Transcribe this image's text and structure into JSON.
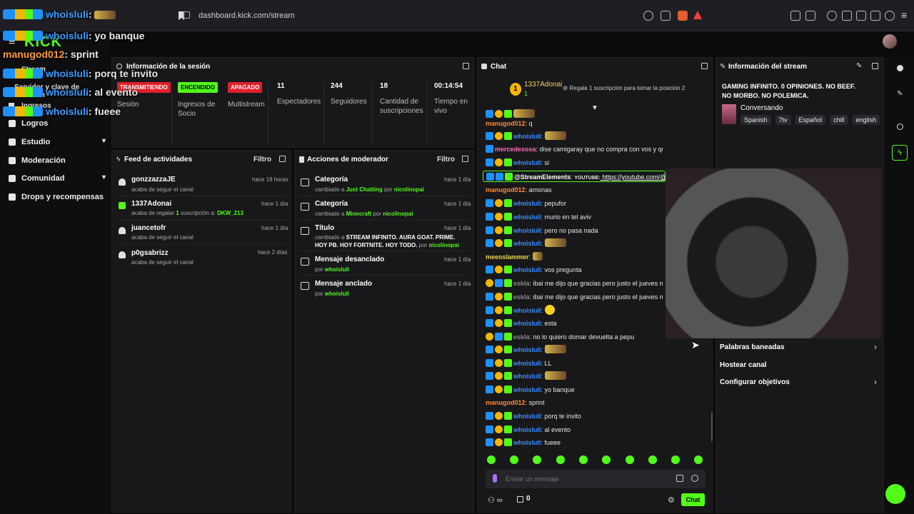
{
  "browser": {
    "url": "dashboard.kick.com/stream"
  },
  "overlay": {
    "lines": [
      {
        "user": "whoisluli",
        "user_color": "blue",
        "text": ""
      },
      {
        "user": "whoisluli",
        "user_color": "blue",
        "text": "yo banque"
      },
      {
        "user": "manugod012",
        "user_color": "orange",
        "text": "sprint"
      },
      {
        "user": "whoisluli",
        "user_color": "blue",
        "text": "porq te invito"
      },
      {
        "user": "whoisluli",
        "user_color": "blue",
        "text": "al evento"
      },
      {
        "user": "whoisluli",
        "user_color": "blue",
        "text": "fueee"
      }
    ]
  },
  "sidebar": {
    "partial_items": [
      "Stream",
      "Servidor y clave de retransm",
      "Ingresos"
    ],
    "items": [
      {
        "label": "Logros",
        "icon": "trophy-icon",
        "chevron": false
      },
      {
        "label": "Estudio",
        "icon": "book-icon",
        "chevron": true
      },
      {
        "label": "Moderación",
        "icon": "wrench-icon",
        "chevron": false
      },
      {
        "label": "Comunidad",
        "icon": "users-icon",
        "chevron": true
      },
      {
        "label": "Drops y recompensas",
        "icon": "gift-icon",
        "chevron": false
      }
    ]
  },
  "session": {
    "title": "Información de la sesión",
    "badges": [
      {
        "text": "TRANSMITIENDO",
        "color": "#e0202a",
        "label": "Sesión"
      },
      {
        "text": "ENCENDIDO",
        "color": "#53fc18",
        "label": "Ingresos de Socio"
      },
      {
        "text": "APAGADO",
        "color": "#e0202a",
        "label": "Multistream"
      }
    ],
    "stats": [
      {
        "value": "11",
        "label": "Espectadores"
      },
      {
        "value": "244",
        "label": "Seguidores"
      },
      {
        "value": "18",
        "label": "Cantidad de suscripciones"
      },
      {
        "value": "00:14:54",
        "label": "Tiempo en vivo"
      }
    ]
  },
  "feed": {
    "title": "Feed de actividades",
    "filter": "Filtro",
    "items": [
      {
        "name": "gonzzazzaJE",
        "sub": "acaba de seguir el canal",
        "time": "hace 19 horas",
        "icon": "heart-icon"
      },
      {
        "name": "1337Adonai",
        "sub_prefix": "acaba de regalar",
        "sub_count": "1",
        "sub_mid": "suscripción a:",
        "sub_target": "DKW_213",
        "time": "hace 1 día",
        "icon": "gift-icon"
      },
      {
        "name": "juancetofr",
        "sub": "acaba de seguir el canal",
        "time": "hace 1 día",
        "icon": "heart-icon"
      },
      {
        "name": "p0gsabrizz",
        "sub": "acaba de seguir el canal",
        "time": "hace 2 días",
        "icon": "heart-icon"
      }
    ]
  },
  "modactions": {
    "title": "Acciones de moderador",
    "filter": "Filtro",
    "items": [
      {
        "title": "Categoría",
        "pre": "cambiado a",
        "value": "Just Chatting",
        "by": "por",
        "user": "nicolinopai",
        "time": "hace 1 día",
        "icon": "category-icon"
      },
      {
        "title": "Categoría",
        "pre": "cambiado a",
        "value": "Minecraft",
        "by": "por",
        "user": "nicolinopai",
        "time": "hace 1 día",
        "icon": "category-icon"
      },
      {
        "title": "Título",
        "pre": "cambiado a",
        "value": "STREAM INFINITO. AURA GOAT. PRIME. HOY PB. HOY FORTNITE. HOY TODO.",
        "by": "por",
        "user": "nicolinopai",
        "time": "hace 1 día",
        "icon": "title-icon"
      },
      {
        "title": "Mensaje desanclado",
        "pre": "por",
        "value": "",
        "by": "",
        "user": "whoisluli",
        "time": "hace 1 día",
        "icon": "unpin-icon"
      },
      {
        "title": "Mensaje anclado",
        "pre": "por",
        "value": "",
        "by": "",
        "user": "whoisluli",
        "time": "hace 1 día",
        "icon": "pin-icon"
      }
    ]
  },
  "chat": {
    "title": "Chat",
    "gift_leader": {
      "name": "1337Adonai",
      "count": "1",
      "prompt": "Regala 1 suscripción para tomar la posición 2"
    },
    "messages": [
      {
        "badges": [
          "blue",
          "coin",
          "green"
        ],
        "user": "",
        "color": "blue",
        "text": "",
        "emote": "wide"
      },
      {
        "badges": [],
        "user": "manugod012",
        "color": "orange",
        "text": "q"
      },
      {
        "badges": [
          "blue",
          "coin",
          "green"
        ],
        "user": "whoisluli",
        "color": "blue",
        "text": "",
        "emote": "wide"
      },
      {
        "badges": [
          "blue"
        ],
        "user": "mercedesosa",
        "color": "pink",
        "text": "dise camigaray que no compra con vos y que sos un moño"
      },
      {
        "badges": [
          "blue",
          "coin",
          "green"
        ],
        "user": "whoisluli",
        "color": "blue",
        "text": "si"
      },
      {
        "badges": [
          "blue",
          "blue",
          "green"
        ],
        "user": "@StreamElements",
        "color": "green",
        "text": "YOUTUBE:",
        "link": "https://youtube.com/@nicol"
      },
      {
        "badges": [],
        "user": "manugod012",
        "color": "orange",
        "text": "amonas"
      },
      {
        "badges": [
          "blue",
          "coin",
          "green"
        ],
        "user": "whoisluli",
        "color": "blue",
        "text": "pepufor"
      },
      {
        "badges": [
          "blue",
          "coin",
          "green"
        ],
        "user": "whoisluli",
        "color": "blue",
        "text": "murio en tel aviv"
      },
      {
        "badges": [
          "blue",
          "coin",
          "green"
        ],
        "user": "whoisluli",
        "color": "blue",
        "text": "pero no pasa nada"
      },
      {
        "badges": [
          "blue",
          "coin",
          "green"
        ],
        "user": "whoisluli",
        "color": "blue",
        "text": "",
        "emote": "wide"
      },
      {
        "badges": [],
        "user": "meeoslammer",
        "color": "yellow",
        "text": "",
        "emote": "small"
      },
      {
        "badges": [
          "blue",
          "coin",
          "green"
        ],
        "user": "whoisluli",
        "color": "blue",
        "text": "vos pregunta"
      },
      {
        "badges": [
          "coin",
          "blue",
          "green"
        ],
        "user": "eskla",
        "color": "gray",
        "text": "ibai me dijo que gracias pero justo el jueves no"
      },
      {
        "badges": [
          "blue",
          "coin",
          "green"
        ],
        "user": "eskla",
        "color": "gray",
        "text": "ibai me dijo que gracias pero justo el jueves no"
      },
      {
        "badges": [
          "blue",
          "coin",
          "green"
        ],
        "user": "whoisluli",
        "color": "blue",
        "text": "",
        "emote": "yellow"
      },
      {
        "badges": [
          "blue",
          "coin",
          "green"
        ],
        "user": "whoisluli",
        "color": "blue",
        "text": "esta"
      },
      {
        "badges": [
          "coin",
          "blue",
          "green"
        ],
        "user": "eskla",
        "color": "gray",
        "text": "no lo quiero domar devuelta a pepu"
      },
      {
        "badges": [
          "blue",
          "coin",
          "green"
        ],
        "user": "whoisluli",
        "color": "blue",
        "text": "",
        "emote": "wide"
      },
      {
        "badges": [
          "blue",
          "coin",
          "green"
        ],
        "user": "whoisluli",
        "color": "blue",
        "text": "LL"
      },
      {
        "badges": [
          "blue",
          "coin",
          "green"
        ],
        "user": "whoisluli",
        "color": "blue",
        "text": "",
        "emote": "wide"
      },
      {
        "badges": [
          "blue",
          "coin",
          "green"
        ],
        "user": "whoisluli",
        "color": "blue",
        "text": "yo banque"
      },
      {
        "badges": [],
        "user": "manugod012",
        "color": "orange",
        "text": "sprint"
      },
      {
        "badges": [
          "blue",
          "coin",
          "green"
        ],
        "user": "whoisluli",
        "color": "blue",
        "text": "porq te invito"
      },
      {
        "badges": [
          "blue",
          "coin",
          "green"
        ],
        "user": "whoisluli",
        "color": "blue",
        "text": "al evento"
      },
      {
        "badges": [
          "blue",
          "coin",
          "green"
        ],
        "user": "whoisluli",
        "color": "blue",
        "text": "fueee"
      }
    ],
    "input_placeholder": "Enviar un mensaje",
    "footer_count": "0",
    "send_label": "Chat"
  },
  "stream_info": {
    "title": "Información del stream",
    "stream_title": "GAMING INFINITO. 0 OPINIONES. NO BEEF. NO MORBO. NO POLEMICA.",
    "category": "Conversando",
    "tags": [
      "Spanish",
      "7tv",
      "Español",
      "chill",
      "english"
    ],
    "menu": [
      {
        "label": "Palabras baneadas",
        "arrow": true
      },
      {
        "label": "Hostear canal",
        "arrow": false
      },
      {
        "label": "Configurar objetivos",
        "arrow": true
      }
    ]
  },
  "colors": {
    "accent": "#53fc18",
    "live": "#e0202a",
    "panel": "#18181b",
    "link_blue": "#3a8dff"
  }
}
